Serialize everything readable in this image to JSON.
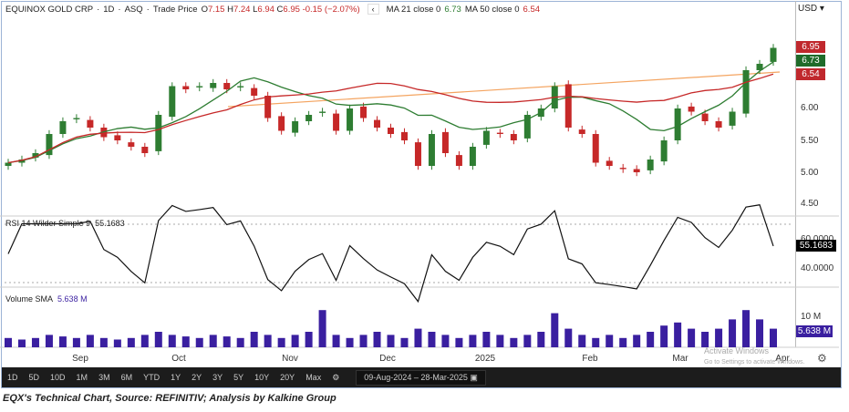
{
  "header": {
    "symbol": "EQUINOX GOLD CRP",
    "interval": "1D",
    "exchange": "ASQ",
    "price_type": "Trade Price",
    "open_label": "O",
    "open": "7.15",
    "high_label": "H",
    "high": "7.24",
    "low_label": "L",
    "low": "6.94",
    "close_label": "C",
    "close": "6.95",
    "change": "-0.15 (−2.07%)",
    "collapse": "‹",
    "ma21_label": "MA 21 close 0",
    "ma21": "6.73",
    "ma50_label": "MA 50 close 0",
    "ma50": "6.54",
    "currency": "USD ▾"
  },
  "rsi": {
    "label": "RSI 14 Wilder Simple 9",
    "value": "55.1683",
    "axis": [
      "60.0000",
      "40.0000"
    ]
  },
  "volume": {
    "label": "Volume SMA",
    "value": "5.638 M",
    "axis": "10 M"
  },
  "price_axis": [
    "6.00",
    "5.50",
    "5.00",
    "4.50"
  ],
  "tags": {
    "close": "6.95",
    "ma21": "6.73",
    "ma50": "6.54"
  },
  "months": [
    "Sep",
    "Oct",
    "Nov",
    "Dec",
    "2025",
    "Feb",
    "Mar",
    "Apr"
  ],
  "toolbar": {
    "periods": [
      "1D",
      "5D",
      "10D",
      "1M",
      "3M",
      "6M",
      "YTD",
      "1Y",
      "2Y",
      "3Y",
      "5Y",
      "10Y",
      "20Y",
      "Max"
    ],
    "range": "09-Aug-2024 – 28-Mar-2025"
  },
  "watermark": {
    "title": "Activate Windows",
    "sub": "Go to Settings to activate Windows."
  },
  "caption": "EQX's Technical Chart, Source: REFINITIV; Analysis by Kalkine Group",
  "colors": {
    "up": "#2e7d32",
    "down": "#c62828",
    "ma21": "#2e7d32",
    "ma50": "#c62828",
    "trend": "#f4a460",
    "volume": "#3a1fa0"
  },
  "chart_data": {
    "type": "candlestick",
    "title": "EQUINOX GOLD CRP 1D",
    "ylabel": "USD",
    "ylim": [
      4.4,
      7.35
    ],
    "x_range": [
      "09-Aug-2024",
      "28-Mar-2025"
    ],
    "closes": [
      5.15,
      5.2,
      5.3,
      5.6,
      5.8,
      5.85,
      5.7,
      5.55,
      5.5,
      5.4,
      5.3,
      5.9,
      6.35,
      6.3,
      6.35,
      6.4,
      6.3,
      6.35,
      6.2,
      5.85,
      5.65,
      5.8,
      5.9,
      5.95,
      5.65,
      6.0,
      5.85,
      5.7,
      5.6,
      5.5,
      5.1,
      5.6,
      5.3,
      5.1,
      5.4,
      5.65,
      5.6,
      5.5,
      5.9,
      6.0,
      6.35,
      5.7,
      5.6,
      5.15,
      5.1,
      5.05,
      5.0,
      5.2,
      5.5,
      6.0,
      5.95,
      5.8,
      5.7,
      5.95,
      6.6,
      6.7,
      6.95
    ],
    "volumes_m": [
      3,
      2.5,
      3,
      4,
      3.5,
      3,
      4,
      3,
      2.5,
      3,
      4,
      5,
      4,
      3.5,
      3,
      4,
      3.5,
      3,
      5,
      4,
      3,
      4,
      5,
      12,
      4,
      3,
      4,
      5,
      4,
      3,
      6,
      5,
      4,
      3,
      4,
      5,
      4,
      3,
      4,
      5,
      11,
      6,
      4,
      3,
      4,
      3,
      4,
      5,
      7,
      8,
      6,
      5,
      6,
      9,
      12,
      9,
      6
    ],
    "ma21_final": 6.73,
    "ma50_final": 6.54,
    "rsi_last": 55.1683,
    "volume_sma_last": 5.638
  }
}
